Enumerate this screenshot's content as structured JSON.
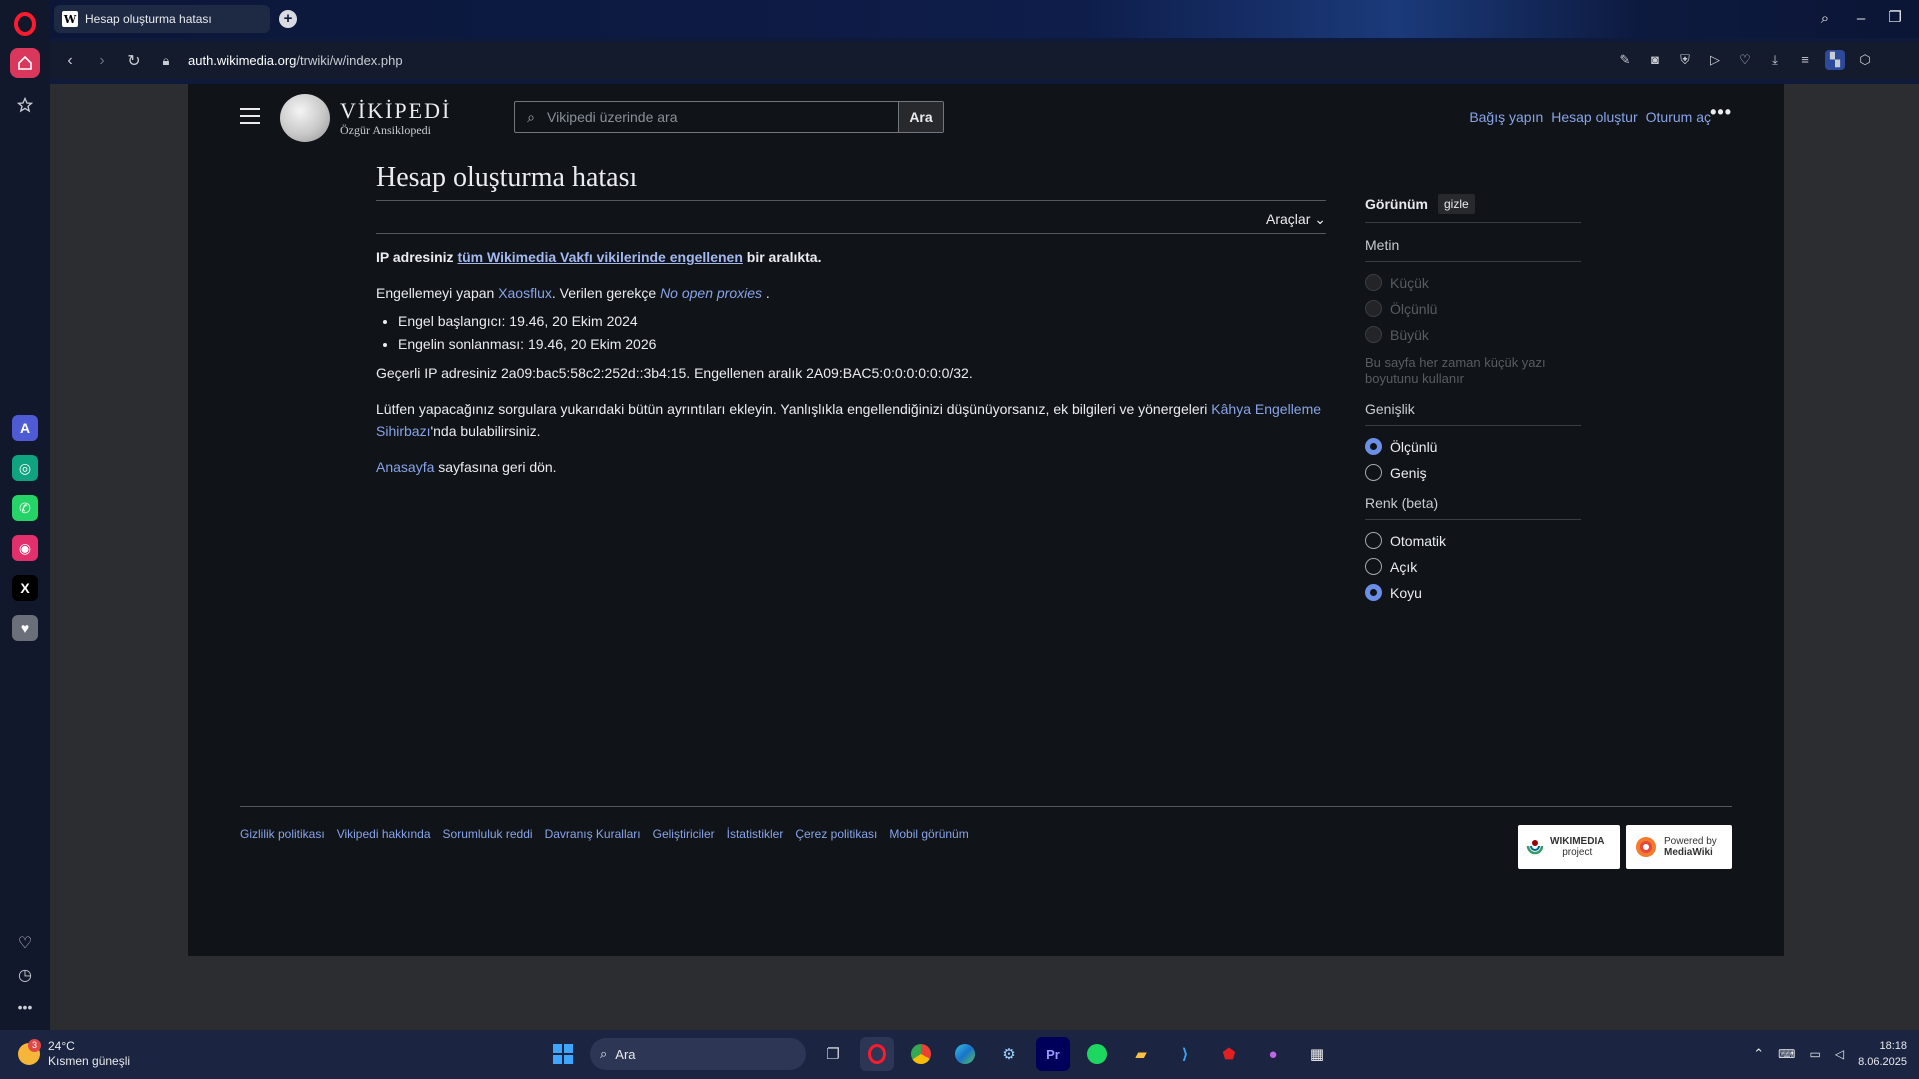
{
  "browser": {
    "tab_title": "Hesap oluşturma hatası",
    "tab_favicon": "W",
    "url_domain": "auth.wikimedia.org",
    "url_path": "/trwiki/w/index.php"
  },
  "header": {
    "site_name": "VİKİPEDİ",
    "tagline": "Özgür Ansiklopedi",
    "search_placeholder": "Vikipedi üzerinde ara",
    "search_button": "Ara",
    "links": [
      "Bağış yapın",
      "Hesap oluştur",
      "Oturum aç"
    ]
  },
  "page": {
    "title": "Hesap oluşturma hatası",
    "tools": "Araçlar",
    "p1_pre": "IP adresiniz ",
    "p1_link": "tüm Wikimedia Vakfı vikilerinde engellenen",
    "p1_post": " bir aralıkta.",
    "p2_pre": "Engellemeyi yapan ",
    "p2_user": "Xaosflux",
    "p2_mid": ". Verilen gerekçe ",
    "p2_reason": "No open proxies",
    "p2_post": " .",
    "li1": "Engel başlangıcı: 19.46, 20 Ekim 2024",
    "li2": "Engelin sonlanması: 19.46, 20 Ekim 2026",
    "p3": "Geçerli IP adresiniz 2a09:bac5:58c2:252d::3b4:15. Engellenen aralık 2A09:BAC5:0:0:0:0:0:0/32.",
    "p4_pre": "Lütfen yapacağınız sorgulara yukarıdaki bütün ayrıntıları ekleyin. Yanlışlıkla engellendiğinizi düşünüyorsanız, ek bilgileri ve yönergeleri ",
    "p4_link": "Kâhya Engelleme Sihirbazı",
    "p4_post": "'nda bulabilirsiniz.",
    "p5_link": "Anasayfa",
    "p5_post": " sayfasına geri dön."
  },
  "appearance": {
    "title": "Görünüm",
    "hide": "gizle",
    "text_label": "Metin",
    "text_opts": [
      "Küçük",
      "Ölçünlü",
      "Büyük"
    ],
    "text_note": "Bu sayfa her zaman küçük yazı boyutunu kullanır",
    "width_label": "Genişlik",
    "width_opts": [
      "Ölçünlü",
      "Geniş"
    ],
    "color_label": "Renk (beta)",
    "color_opts": [
      "Otomatik",
      "Açık",
      "Koyu"
    ]
  },
  "footer": {
    "links": [
      "Gizlilik politikası",
      "Vikipedi hakkında",
      "Sorumluluk reddi",
      "Davranış Kuralları",
      "Geliştiriciler",
      "İstatistikler",
      "Çerez politikası",
      "Mobil görünüm"
    ],
    "badge1": "WIKIMEDIA",
    "badge1_sub": "project",
    "badge2_a": "Powered by",
    "badge2_b": "MediaWiki"
  },
  "taskbar": {
    "weather_badge": "3",
    "temp": "24°C",
    "condition": "Kısmen güneşli",
    "search": "Ara",
    "time": "18:18",
    "date": "8.06.2025"
  },
  "colors": {
    "link": "#88a3e8",
    "bg": "#101418",
    "accent": "#6b8ee6",
    "opera": "#ff1b2d"
  }
}
